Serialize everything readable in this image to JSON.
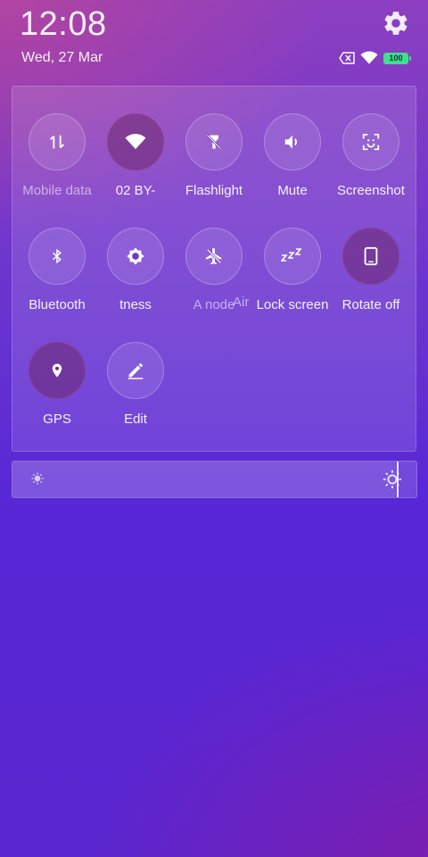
{
  "header": {
    "time": "12:08",
    "date": "Wed, 27 Mar",
    "battery_level": "100",
    "icons": {
      "settings": "gear-icon",
      "sim": "no-sim-icon",
      "wifi": "wifi-icon",
      "battery": "battery-icon"
    }
  },
  "quick_settings": {
    "tiles": [
      {
        "label": "Mobile data",
        "icon": "mobile-data-icon",
        "active": false,
        "dim": true
      },
      {
        "label": "02       BY-",
        "icon": "wifi-icon",
        "active": true,
        "dim": false
      },
      {
        "label": "Flashlight",
        "icon": "flashlight-icon",
        "active": false,
        "dim": false
      },
      {
        "label": "Mute",
        "icon": "volume-icon",
        "active": false,
        "dim": false
      },
      {
        "label": "Screenshot",
        "icon": "screenshot-icon",
        "active": false,
        "dim": false
      },
      {
        "label": "Bluetooth",
        "icon": "bluetooth-icon",
        "active": false,
        "dim": false
      },
      {
        "label": "tness",
        "icon": "brightness-icon",
        "active": false,
        "dim": false
      },
      {
        "label": "A  node",
        "icon": "airplane-icon",
        "active": false,
        "dim": true
      },
      {
        "label": "Lock screen",
        "icon": "sleep-icon",
        "active": false,
        "dim": false
      },
      {
        "label": "Rotate off",
        "icon": "rotate-icon",
        "active": true,
        "dim": false
      },
      {
        "label": "GPS",
        "icon": "location-icon",
        "active": true,
        "dim": false
      },
      {
        "label": "Edit",
        "icon": "edit-icon",
        "active": false,
        "dim": false
      }
    ],
    "overlap_label": "Air"
  },
  "brightness": {
    "level": 0.95,
    "icons": {
      "low": "sun-small-icon",
      "high": "sun-large-icon"
    }
  },
  "colors": {
    "accent": "#5727d6",
    "battery": "#3ee08a"
  }
}
